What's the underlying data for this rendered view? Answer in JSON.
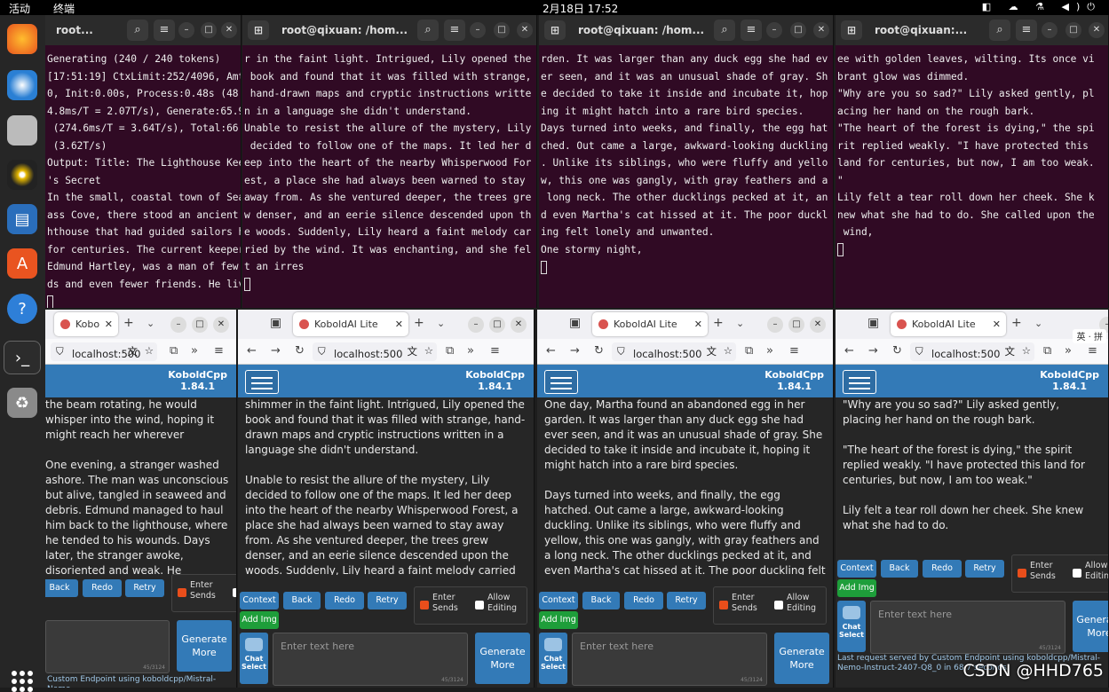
{
  "topbar": {
    "activities": "活动",
    "app": "终端",
    "clock": "2月18日 17:52",
    "tray": "◧ ☁ ⚗ ◀)⏻"
  },
  "dock": {
    "items": [
      "firefox-icon",
      "thunderbird-icon",
      "files-icon",
      "rhythmbox-icon",
      "writer-icon",
      "appcenter-icon",
      "help-icon",
      "terminal-icon",
      "trash-icon"
    ]
  },
  "terminals": [
    {
      "title": "root...",
      "lines": [
        "Generating (240 / 240 tokens)",
        "[17:51:19] CtxLimit:252/4096, Amt:24",
        "0, Init:0.00s, Process:0.48s (48",
        "4.8ms/T = 2.07T/s), Generate:65.91s",
        " (274.6ms/T = 3.64T/s), Total:66.39s",
        " (3.62T/s)",
        "Output: Title: The Lighthouse Keeper",
        "'s Secret",
        "",
        "In the small, coastal town of Sea Gl",
        "ass Cove, there stood an ancient lig",
        "hthouse that had guided sailors home",
        "for centuries. The current keeper,",
        "Edmund Hartley, was a man of few wor",
        "ds and even fewer friends. He lived"
      ]
    },
    {
      "title": "root@qixuan: /hom...",
      "lines": [
        "r in the faint light. Intrigued, Lily opened the",
        " book and found that it was filled with strange,",
        " hand-drawn maps and cryptic instructions writte",
        "n in a language she didn't understand.",
        "",
        "Unable to resist the allure of the mystery, Lily",
        " decided to follow one of the maps. It led her d",
        "eep into the heart of the nearby Whisperwood For",
        "est, a place she had always been warned to stay",
        "away from. As she ventured deeper, the trees gre",
        "w denser, and an eerie silence descended upon th",
        "e woods. Suddenly, Lily heard a faint melody car",
        "ried by the wind. It was enchanting, and she fel",
        "t an irres"
      ]
    },
    {
      "title": "root@qixuan: /hom...",
      "lines": [
        "rden. It was larger than any duck egg she had ev",
        "er seen, and it was an unusual shade of gray. Sh",
        "e decided to take it inside and incubate it, hop",
        "ing it might hatch into a rare bird species.",
        "",
        "Days turned into weeks, and finally, the egg hat",
        "ched. Out came a large, awkward-looking duckling",
        ". Unlike its siblings, who were fluffy and yello",
        "w, this one was gangly, with gray feathers and a",
        " long neck. The other ducklings pecked at it, an",
        "d even Martha's cat hissed at it. The poor duckl",
        "ing felt lonely and unwanted.",
        "",
        "One stormy night,"
      ]
    },
    {
      "title": "root@qixuan:...",
      "lines": [
        "ee with golden leaves, wilting. Its once vi",
        "brant glow was dimmed.",
        "",
        "\"Why are you so sad?\" Lily asked gently, pl",
        "acing her hand on the rough bark.",
        "",
        "\"The heart of the forest is dying,\" the spi",
        "rit replied weakly. \"I have protected this",
        "land for centuries, but now, I am too weak.",
        "\"",
        "",
        "Lily felt a tear roll down her cheek. She k",
        "new what she had to do. She called upon the",
        " wind,"
      ]
    }
  ],
  "browsers": [
    {
      "tab": "Kobo",
      "url": "localhost:500",
      "story": [
        "the beam rotating, he would whisper into the wind, hoping it might reach her wherever",
        "One evening, a stranger washed ashore. The man was unconscious but alive, tangled in seaweed and debris. Edmund managed to haul him back to the lighthouse, where he tended to his wounds. Days later, the stranger awoke, disoriented and weak. He introduced himself as Elias, a sailor from a nearby island who'd been caught in a squall."
      ],
      "footer": "Custom Endpoint using koboldcpp/Mistral-Nemo-"
    },
    {
      "tab": "KoboldAI Lite",
      "url": "localhost:500",
      "story": [
        "shimmer in the faint light. Intrigued, Lily opened the book and found that it was filled with strange, hand-drawn maps and cryptic instructions written in a language she didn't understand.",
        "Unable to resist the allure of the mystery, Lily decided to follow one of the maps. It led her deep into the heart of the nearby Whisperwood Forest, a place she had always been warned to stay away from. As she ventured deeper, the trees grew denser, and an eerie silence descended upon the woods. Suddenly, Lily heard a faint melody carried by the wind."
      ],
      "footer": ""
    },
    {
      "tab": "KoboldAI Lite",
      "url": "localhost:500",
      "story": [
        "One day, Martha found an abandoned egg in her garden. It was larger than any duck egg she had ever seen, and it was an unusual shade of gray. She decided to take it inside and incubate it, hoping it might hatch into a rare bird species.",
        "Days turned into weeks, and finally, the egg hatched. Out came a large, awkward-looking duckling. Unlike its siblings, who were fluffy and yellow, this one was gangly, with gray feathers and a long neck. The other ducklings pecked at it, and even Martha's cat hissed at it. The poor duckling felt lonely and unwanted."
      ],
      "footer": ""
    },
    {
      "tab": "KoboldAI Lite",
      "url": "localhost:500",
      "story": [
        "\"Why are you so sad?\" Lily asked gently, placing her hand on the rough bark.",
        "\"The heart of the forest is dying,\" the spirit replied weakly. \"I have protected this land for centuries, but now, I am too weak.\"",
        "Lily felt a tear roll down her cheek. She knew what she had to do."
      ],
      "footer": "Last request served by Custom Endpoint using koboldcpp/Mistral-Nemo-Instruct-2407-Q8_0 in 68.7 seconds."
    }
  ],
  "kobold": {
    "name": "KoboldCpp",
    "version": "1.84.1",
    "context": "Context",
    "back": "Back",
    "redo": "Redo",
    "retry": "Retry",
    "add_img": "Add Img",
    "enter_sends": "Enter Sends",
    "allow_editing": "Allow Editing",
    "chat_select": "Chat Select",
    "placeholder": "Enter text here",
    "generate": "Generate More",
    "counter": "45/3124"
  },
  "ime": {
    "label": "英 · 拼"
  },
  "watermark": "CSDN @HHD765"
}
